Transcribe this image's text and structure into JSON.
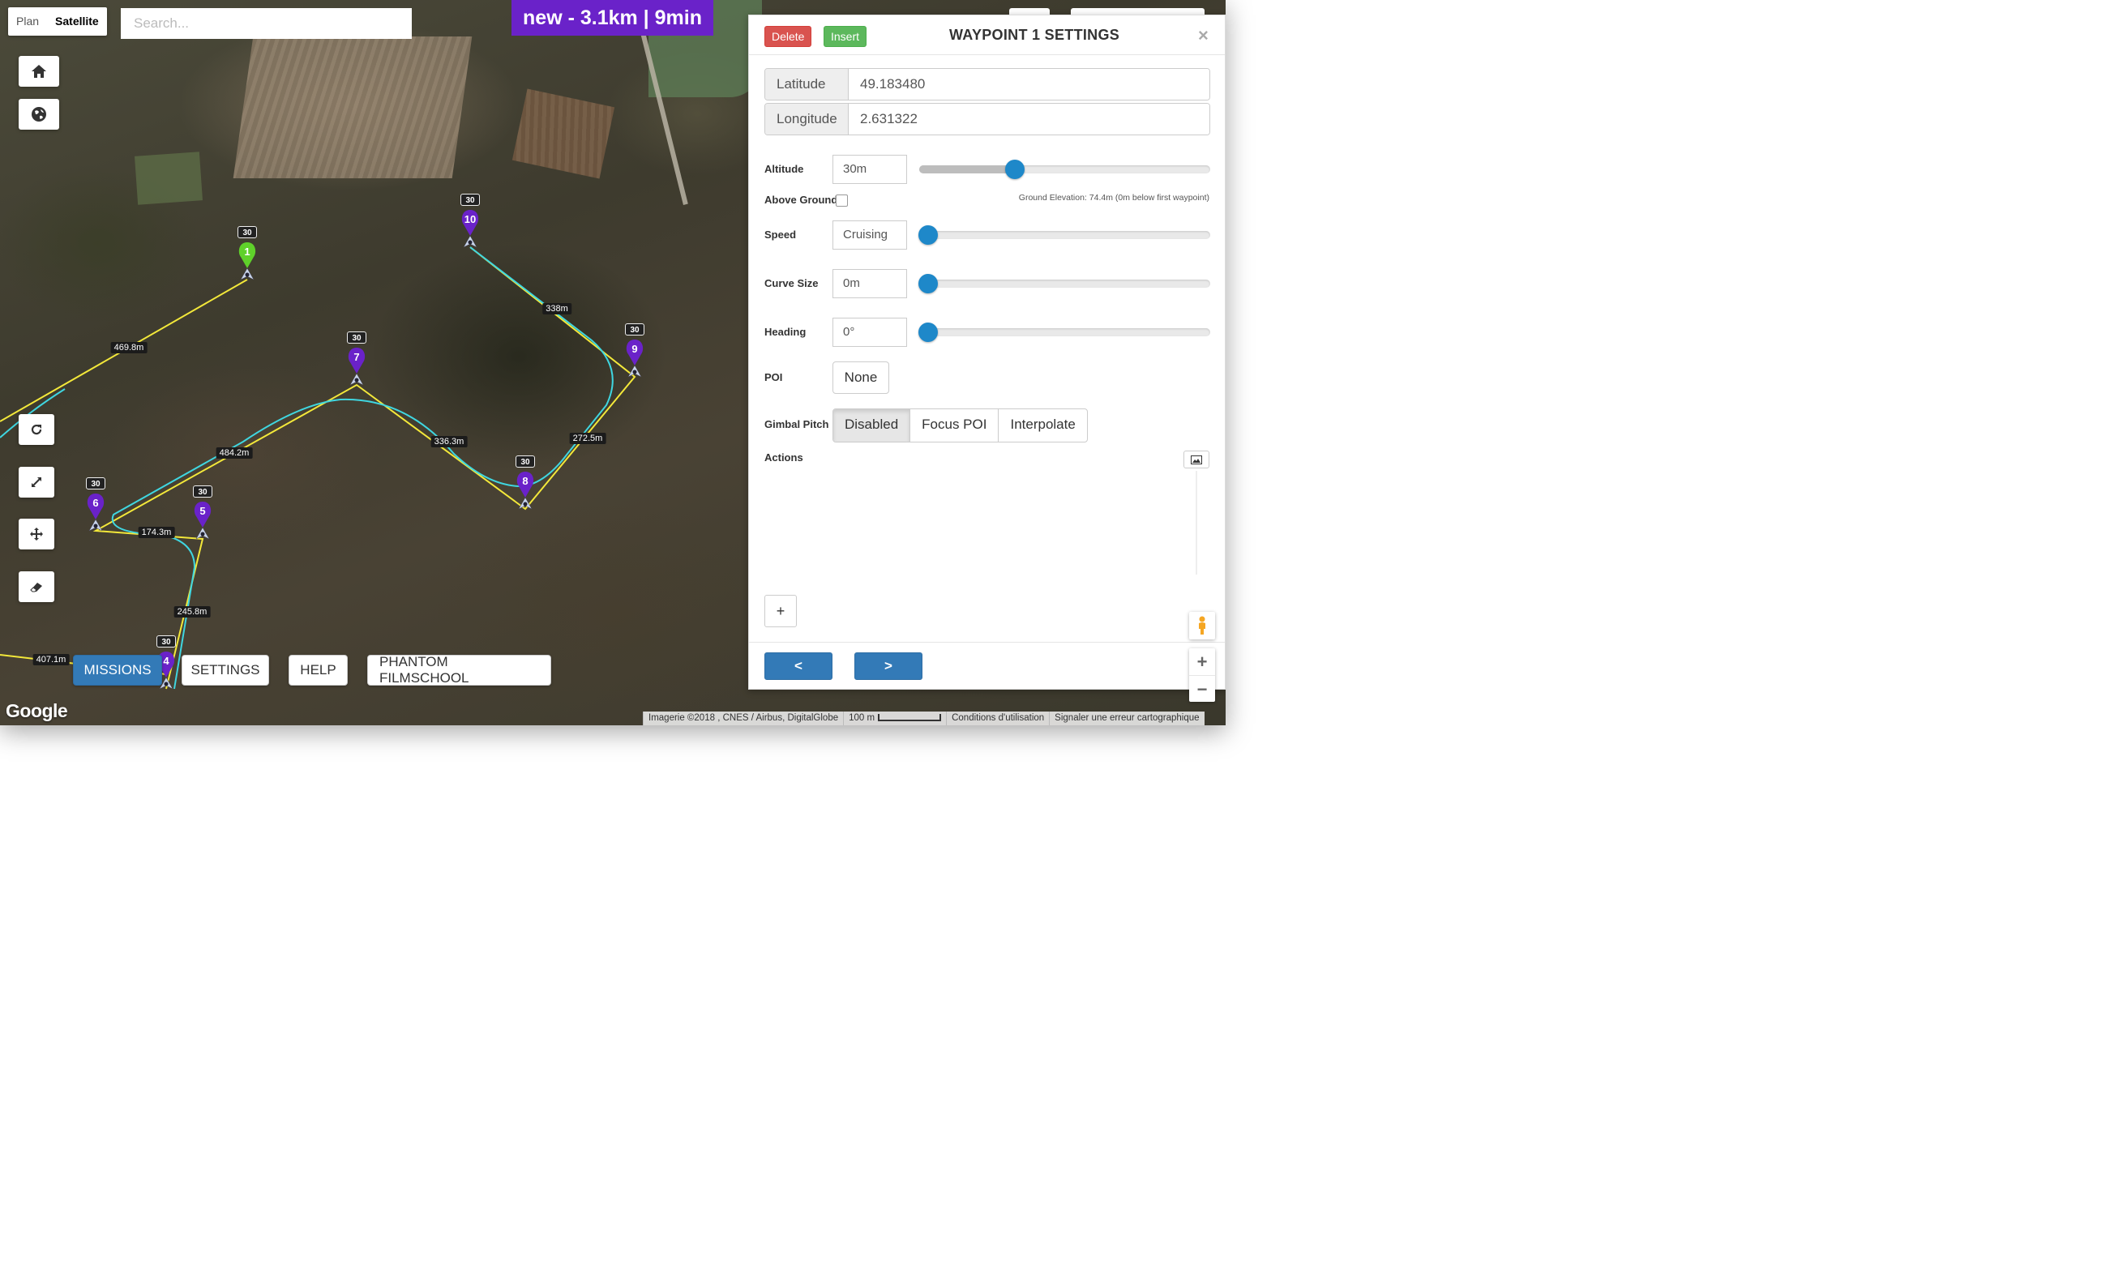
{
  "map": {
    "type_plan": "Plan",
    "type_satellite": "Satellite",
    "search_placeholder": "Search...",
    "banner": "new - 3.1km | 9min",
    "google_logo": "Google",
    "attribution": "Imagerie ©2018 , CNES / Airbus, DigitalGlobe",
    "scale": "100 m",
    "terms": "Conditions d'utilisation",
    "report": "Signaler une erreur cartographique",
    "controls": [
      "home-icon",
      "globe-icon",
      "refresh-icon",
      "expand-icon",
      "move-icon",
      "eraser-icon"
    ],
    "waypoints": [
      {
        "n": "1",
        "alt": "30",
        "color": "#5fd12a"
      },
      {
        "n": "4",
        "alt": "30",
        "color": "#6a22c9"
      },
      {
        "n": "5",
        "alt": "30",
        "color": "#6a22c9"
      },
      {
        "n": "6",
        "alt": "30",
        "color": "#6a22c9"
      },
      {
        "n": "7",
        "alt": "30",
        "color": "#6a22c9"
      },
      {
        "n": "8",
        "alt": "30",
        "color": "#6a22c9"
      },
      {
        "n": "9",
        "alt": "30",
        "color": "#6a22c9"
      },
      {
        "n": "10",
        "alt": "30",
        "color": "#6a22c9"
      }
    ],
    "distances": [
      "469.8m",
      "338m",
      "336.3m",
      "272.5m",
      "484.2m",
      "174.3m",
      "245.8m",
      "407.1m"
    ]
  },
  "menu": {
    "missions": "MISSIONS",
    "settings": "SETTINGS",
    "help": "HELP",
    "filmschool": "PHANTOM FILMSCHOOL"
  },
  "panel": {
    "delete": "Delete",
    "insert": "Insert",
    "title": "WAYPOINT 1 SETTINGS",
    "close": "×",
    "latitude_label": "Latitude",
    "latitude": "49.183480",
    "longitude_label": "Longitude",
    "longitude": "2.631322",
    "altitude_label": "Altitude",
    "altitude": "30m",
    "altitude_level": 0.33,
    "above_ground_label": "Above Ground",
    "ground_elevation": "Ground Elevation: 74.4m (0m below first waypoint)",
    "speed_label": "Speed",
    "speed": "Cruising",
    "curve_label": "Curve Size",
    "curve": "0m",
    "heading_label": "Heading",
    "heading": "0°",
    "poi_label": "POI",
    "poi": "None",
    "gimbal_label": "Gimbal Pitch",
    "gimbal_options": [
      "Disabled",
      "Focus POI",
      "Interpolate"
    ],
    "gimbal_selected": "Disabled",
    "actions_label": "Actions",
    "add": "+",
    "prev": "<",
    "next": ">"
  },
  "colors": {
    "accent": "#337ab7",
    "banner": "#6a22c9",
    "route": "#f3e83a",
    "curve": "#3fd6e0",
    "slider": "#1e88c9"
  }
}
